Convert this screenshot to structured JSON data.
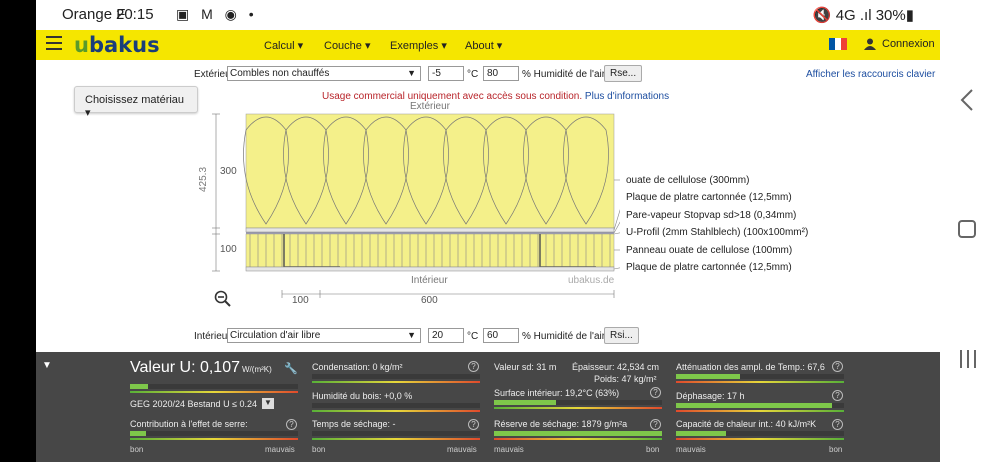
{
  "status": {
    "carrier": "Orange F",
    "time": "20:15",
    "icons": "▣ M ◉ •",
    "right": "🔇 4G .ıl 30%▮"
  },
  "header": {
    "logo_prefix": "u",
    "logo_rest": "bakus",
    "nav": [
      "Calcul ▾",
      "Couche ▾",
      "Exemples ▾",
      "About ▾"
    ],
    "login": "Connexion",
    "flag_colors": [
      "#0055a4",
      "#ffffff",
      "#ef4135"
    ]
  },
  "exterior": {
    "label": "Extérieur",
    "select": "Combles non chauffés",
    "temp": "-5",
    "temp_unit": "°C",
    "humidity": "80",
    "humidity_label": "% Humidité de l'air",
    "button": "Rse..."
  },
  "shortcuts_link": "Afficher les raccourcis clavier",
  "material_button": "Choisissez matériau ▾",
  "notice": {
    "text": "Usage commercial uniquement avec accès sous condition.",
    "link": "Plus d'informations"
  },
  "diagram": {
    "top_label": "Extérieur",
    "bottom_label": "Intérieur",
    "watermark": "ubakus.de",
    "total": "425.3",
    "dim_top": "300",
    "dim_bottom": "100",
    "dim_x1": "100",
    "dim_x2": "600",
    "layers": [
      "ouate de cellulose (300mm)",
      "Plaque de platre cartonnée (12,5mm)",
      "Pare-vapeur Stopvap sd>18 (0,34mm)",
      "U-Profil (2mm Stahlblech) (100x100mm²)",
      "Panneau ouate de cellulose (100mm)",
      "Plaque de platre cartonnée (12,5mm)"
    ]
  },
  "interior": {
    "label": "Intérieur",
    "select": "Circulation d'air libre",
    "temp": "20",
    "temp_unit": "°C",
    "humidity": "60",
    "humidity_label": "% Humidité de l'air",
    "button": "Rsi..."
  },
  "results": {
    "u_value_label": "Valeur U: 0,107",
    "u_unit": "W/(m²K)",
    "geg": "GEG 2020/24 Bestand U ≤ 0.24",
    "condensation": "Condensation: 0 kg/m²",
    "humidity_wood": "Humidité du bois: +0,0 %",
    "drying_time": "Temps de séchage: -",
    "greenhouse": "Contribution à l'effet de serre:",
    "sd": "Valeur sd: 31 m",
    "thickness": "Épaisseur: 42,534 cm",
    "weight": "Poids: 47 kg/m²",
    "surface": "Surface intérieur: 19,2°C (63%)",
    "drying_reserve": "Réserve de séchage: 1879 g/m²a",
    "attenuation": "Atténuation des ampl. de Temp.: 67,6",
    "phase_shift": "Déphasage: 17 h",
    "heat_capacity": "Capacité de chaleur int.: 40 kJ/m²K",
    "good": "bon",
    "bad": "mauvais",
    "qmark": "?"
  }
}
